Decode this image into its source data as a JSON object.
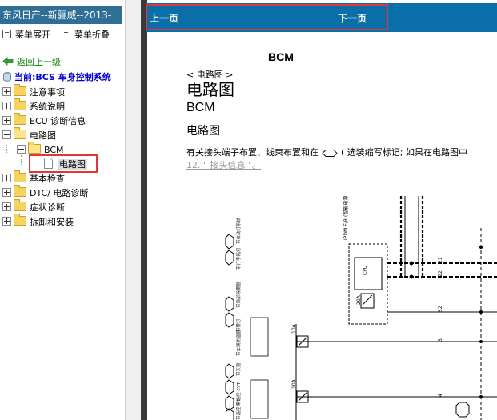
{
  "sidebar": {
    "app_title": "东风日产--新骊威--2013-",
    "expand_label": "菜单展开",
    "collapse_label": "菜单折叠",
    "back_label": "返回上一级",
    "current_label": "当前:BCS 车身控制系统",
    "tree": [
      {
        "label": "注意事项",
        "state": "collapsed"
      },
      {
        "label": "系统说明",
        "state": "collapsed"
      },
      {
        "label": "ECU 诊断信息",
        "state": "collapsed"
      },
      {
        "label": "电路图",
        "state": "expanded"
      },
      {
        "label": "BCM",
        "state": "expanded",
        "level": 1
      },
      {
        "label": "电路图",
        "state": "leaf",
        "level": 2,
        "selected": true
      },
      {
        "label": "基本检查",
        "state": "collapsed"
      },
      {
        "label": "DTC/ 电路诊断",
        "state": "collapsed"
      },
      {
        "label": "症状诊断",
        "state": "collapsed"
      },
      {
        "label": "拆卸和安装",
        "state": "collapsed"
      }
    ]
  },
  "navbar": {
    "prev_label": "上一页",
    "next_label": "下一页"
  },
  "document": {
    "heading": "BCM",
    "breadcrumb": "< 电路图 >",
    "title_main": "电路图",
    "title_sub": "BCM",
    "section_title": "电路图",
    "body_text_before": "有关接头端子布置、线束布置和在",
    "body_text_after": "( 选装缩写标记; 如果在电路图中",
    "body_link": "12. \" 接头信息 \"。"
  },
  "diagram": {
    "ipdm_label": "IPDM E/R (智能电源分配模块)",
    "cpu_label": "CPU",
    "fuse1": "20A",
    "fuse2": "10A",
    "fuse3": "10A",
    "pins": [
      "21",
      "22",
      "52",
      "3",
      "4"
    ],
    "side_labels": [
      "带自动灯系统",
      "带行李箱灯",
      "带后部除雾器",
      "带雾灯",
      "带车辆防盗器",
      "带天窗",
      "带遥控 CVT",
      "带遥控 MT"
    ]
  },
  "colors": {
    "title_bar": "#2f6e96",
    "nav_bar": "#0a6ea8",
    "highlight": "#e0353a",
    "link_green": "#008000",
    "current_blue": "#0000cc"
  }
}
